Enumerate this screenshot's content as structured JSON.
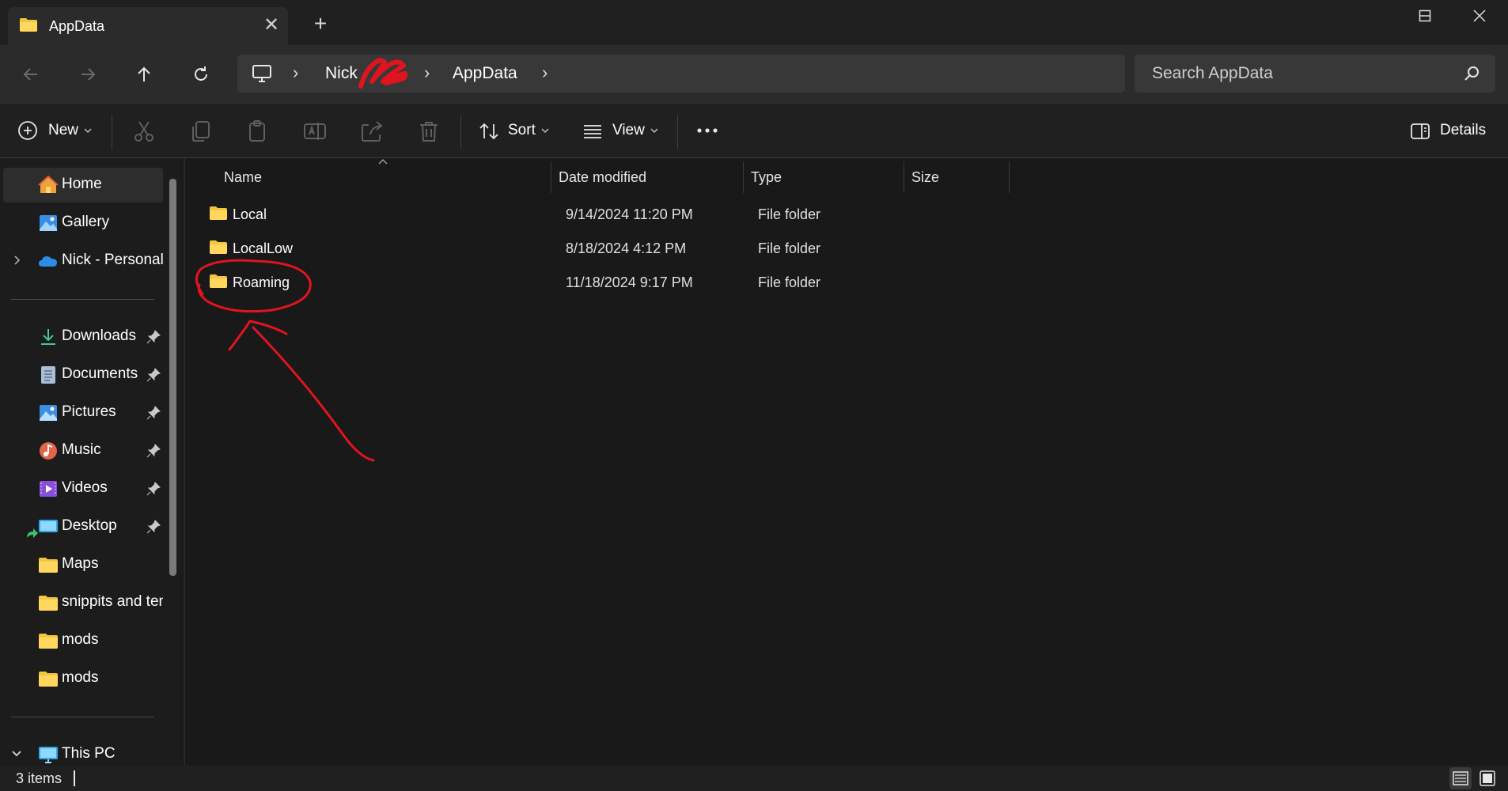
{
  "window": {
    "tab_title": "AppData",
    "new_tab_symbol": "+",
    "close_tab_symbol": "✕",
    "minimize_symbol": "—",
    "maximize_symbol": "☐",
    "close_symbol": "✕"
  },
  "breadcrumb": {
    "items": [
      "Nick",
      "AppData"
    ]
  },
  "search": {
    "placeholder": "Search AppData"
  },
  "toolbar": {
    "new_label": "New",
    "sort_label": "Sort",
    "view_label": "View",
    "details_label": "Details"
  },
  "sidebar": {
    "top_items": [
      {
        "label": "Home",
        "icon": "home-icon",
        "selected": true
      },
      {
        "label": "Gallery",
        "icon": "gallery-icon"
      },
      {
        "label": "Nick - Personal",
        "icon": "onedrive-icon"
      }
    ],
    "quick_access": [
      {
        "label": "Downloads",
        "icon": "downloads-icon",
        "pinned": true
      },
      {
        "label": "Documents",
        "icon": "documents-icon",
        "pinned": true
      },
      {
        "label": "Pictures",
        "icon": "pictures-icon",
        "pinned": true
      },
      {
        "label": "Music",
        "icon": "music-icon",
        "pinned": true
      },
      {
        "label": "Videos",
        "icon": "videos-icon",
        "pinned": true
      },
      {
        "label": "Desktop",
        "icon": "desktop-icon",
        "pinned": true
      },
      {
        "label": "Maps",
        "icon": "folder-icon"
      },
      {
        "label": "snippits and ten",
        "icon": "folder-icon"
      },
      {
        "label": "mods",
        "icon": "folder-icon"
      },
      {
        "label": "mods",
        "icon": "folder-icon"
      }
    ],
    "this_pc_label": "This PC"
  },
  "details": {
    "columns": [
      "Name",
      "Date modified",
      "Type",
      "Size"
    ],
    "rows": [
      {
        "name": "Local",
        "date": "9/14/2024 11:20 PM",
        "type": "File folder",
        "size": ""
      },
      {
        "name": "LocalLow",
        "date": "8/18/2024 4:12 PM",
        "type": "File folder",
        "size": ""
      },
      {
        "name": "Roaming",
        "date": "11/18/2024 9:17 PM",
        "type": "File folder",
        "size": ""
      }
    ]
  },
  "status": {
    "item_count": "3 items"
  },
  "colors": {
    "folder": "#f3c73d",
    "annotation": "#e0141e",
    "accent": "#4cc2ff"
  }
}
